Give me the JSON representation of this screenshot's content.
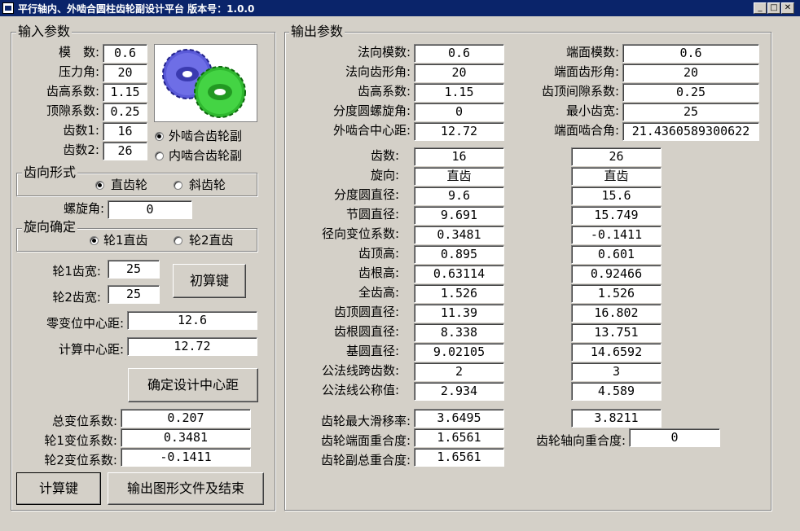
{
  "window": {
    "title": "平行轴内、外啮合圆柱齿轮副设计平台 版本号：1.0.0"
  },
  "input": {
    "title": "输入参数",
    "fields": [
      {
        "label": "模　数:",
        "value": "0.6"
      },
      {
        "label": "压力角:",
        "value": "20"
      },
      {
        "label": "齿高系数:",
        "value": "1.15"
      },
      {
        "label": "顶隙系数:",
        "value": "0.25"
      },
      {
        "label": "齿数1:",
        "value": "16"
      },
      {
        "label": "齿数2:",
        "value": "26"
      }
    ],
    "mesh_type": {
      "external": "外啮合齿轮副",
      "internal": "内啮合齿轮副",
      "selected": "external"
    },
    "tooth_direction": {
      "title": "齿向形式",
      "spur": "直齿轮",
      "helical": "斜齿轮",
      "selected": "spur"
    },
    "helix_angle": {
      "label": "螺旋角:",
      "value": "0"
    },
    "hand": {
      "title": "旋向确定",
      "opt1": "轮1直齿",
      "opt2": "轮2直齿",
      "selected": "opt1"
    },
    "width1": {
      "label": "轮1齿宽:",
      "value": "25"
    },
    "width2": {
      "label": "轮2齿宽:",
      "value": "25"
    },
    "init_calc_button": "初算键",
    "zero_center": {
      "label": "零变位中心距:",
      "value": "12.6"
    },
    "calc_center": {
      "label": "计算中心距:",
      "value": "12.72"
    },
    "confirm_button": "确定设计中心距",
    "total_shift": {
      "label": "总变位系数:",
      "value": "0.207"
    },
    "shift1": {
      "label": "轮1变位系数:",
      "value": "0.3481"
    },
    "shift2": {
      "label": "轮2变位系数:",
      "value": "-0.1411"
    },
    "calc_button": "计算键",
    "export_button": "输出图形文件及结束"
  },
  "output": {
    "title": "输出参数",
    "left_params": [
      {
        "label": "法向模数:",
        "value": "0.6"
      },
      {
        "label": "法向齿形角:",
        "value": "20"
      },
      {
        "label": "齿高系数:",
        "value": "1.15"
      },
      {
        "label": "分度圆螺旋角:",
        "value": "0"
      },
      {
        "label": "外啮合中心距:",
        "value": "12.72"
      }
    ],
    "right_params": [
      {
        "label": "端面模数:",
        "value": "0.6"
      },
      {
        "label": "端面齿形角:",
        "value": "20"
      },
      {
        "label": "齿顶间隙系数:",
        "value": "0.25"
      },
      {
        "label": "最小齿宽:",
        "value": "25"
      },
      {
        "label": "端面啮合角:",
        "value": "21.4360589300622"
      }
    ],
    "gear_rows": [
      {
        "label": "齿数:",
        "g1": "16",
        "g2": "26"
      },
      {
        "label": "旋向:",
        "g1": "直齿",
        "g2": "直齿"
      },
      {
        "label": "分度圆直径:",
        "g1": "9.6",
        "g2": "15.6"
      },
      {
        "label": "节圆直径:",
        "g1": "9.691",
        "g2": "15.749"
      },
      {
        "label": "径向变位系数:",
        "g1": "0.3481",
        "g2": "-0.1411"
      },
      {
        "label": "齿顶高:",
        "g1": "0.895",
        "g2": "0.601"
      },
      {
        "label": "齿根高:",
        "g1": "0.63114",
        "g2": "0.92466"
      },
      {
        "label": "全齿高:",
        "g1": "1.526",
        "g2": "1.526"
      },
      {
        "label": "齿顶圆直径:",
        "g1": "11.39",
        "g2": "16.802"
      },
      {
        "label": "齿根圆直径:",
        "g1": "8.338",
        "g2": "13.751"
      },
      {
        "label": "基圆直径:",
        "g1": "9.02105",
        "g2": "14.6592"
      },
      {
        "label": "公法线跨齿数:",
        "g1": "2",
        "g2": "3"
      },
      {
        "label": "公法线公称值:",
        "g1": "2.934",
        "g2": "4.589"
      }
    ],
    "max_slip": {
      "label": "齿轮最大滑移率:",
      "g1": "3.6495",
      "g2": "3.8211"
    },
    "transverse_contact": {
      "label": "齿轮端面重合度:",
      "value": "1.6561"
    },
    "axial_contact": {
      "label": "齿轮轴向重合度:",
      "value": "0"
    },
    "total_contact": {
      "label": "齿轮副总重合度:",
      "value": "1.6561"
    }
  }
}
